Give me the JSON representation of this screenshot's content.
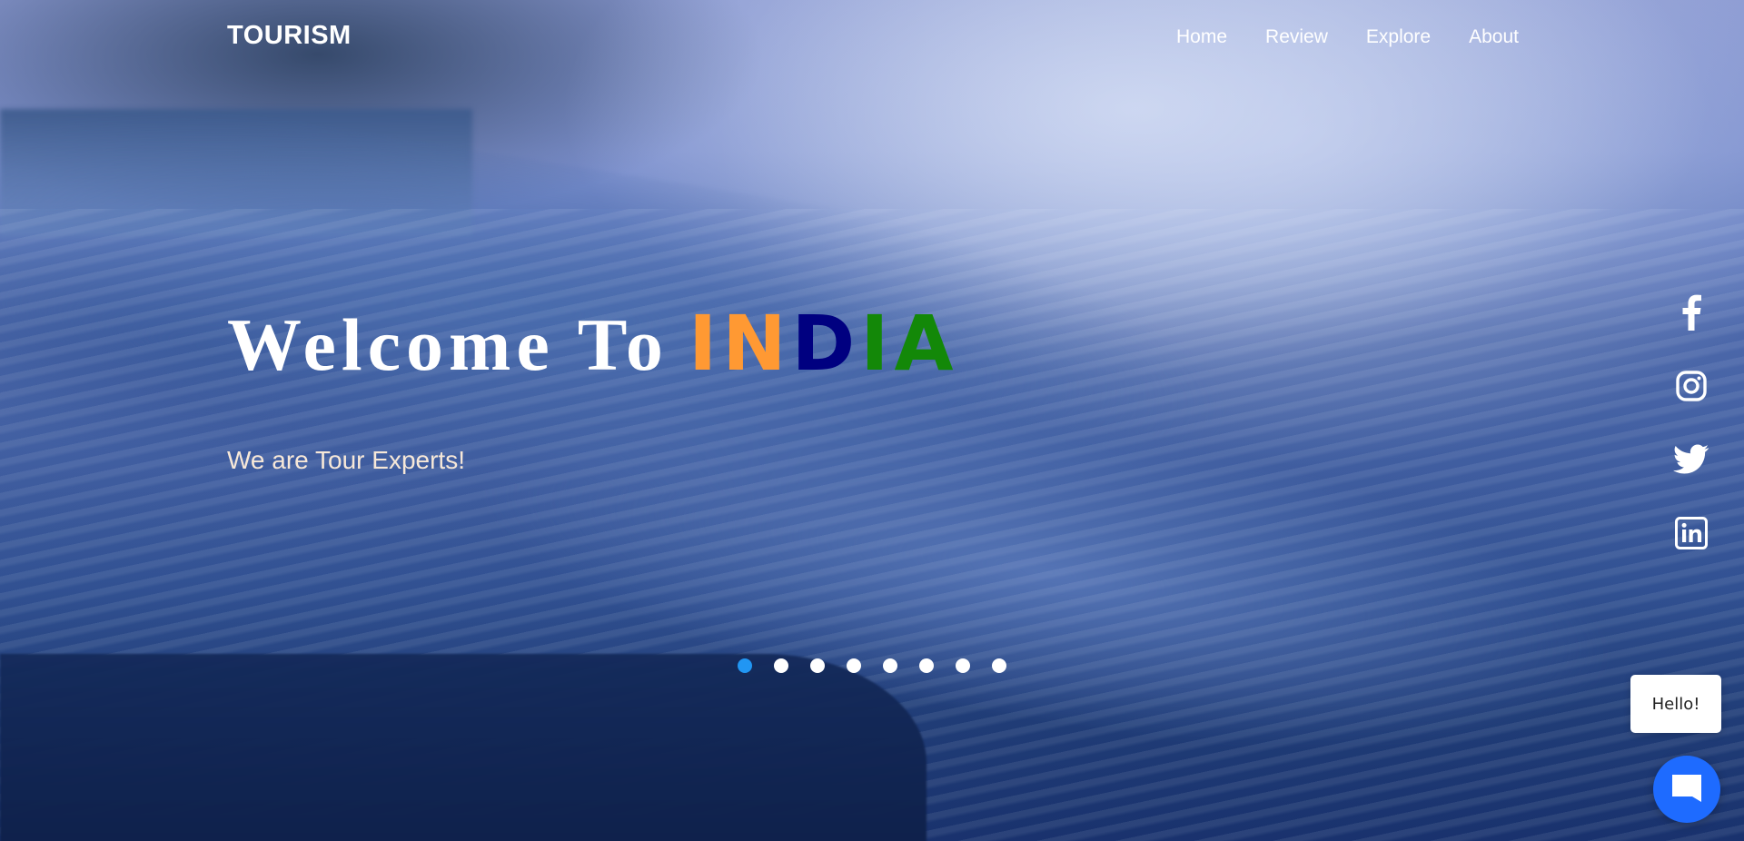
{
  "nav": {
    "logo": "TOURISM",
    "links": [
      {
        "label": "Home"
      },
      {
        "label": "Review"
      },
      {
        "label": "Explore"
      },
      {
        "label": "About"
      }
    ]
  },
  "hero": {
    "welcome": "Welcome To",
    "country_letters": [
      {
        "char": "I",
        "color": "#ff9933"
      },
      {
        "char": "N",
        "color": "#ff9933"
      },
      {
        "char": "D",
        "color": "#000080"
      },
      {
        "char": "I",
        "color": "#138808"
      },
      {
        "char": "A",
        "color": "#138808"
      }
    ],
    "tagline": "We are Tour Experts!"
  },
  "carousel": {
    "slide_count": 8,
    "active_index": 0,
    "active_color": "#2196f3"
  },
  "social": [
    {
      "icon": "facebook-icon"
    },
    {
      "icon": "instagram-icon"
    },
    {
      "icon": "twitter-icon"
    },
    {
      "icon": "linkedin-icon"
    }
  ],
  "chat": {
    "greeting": "Hello!",
    "icon": "chat-bubble-icon",
    "color": "#1e6bff"
  }
}
